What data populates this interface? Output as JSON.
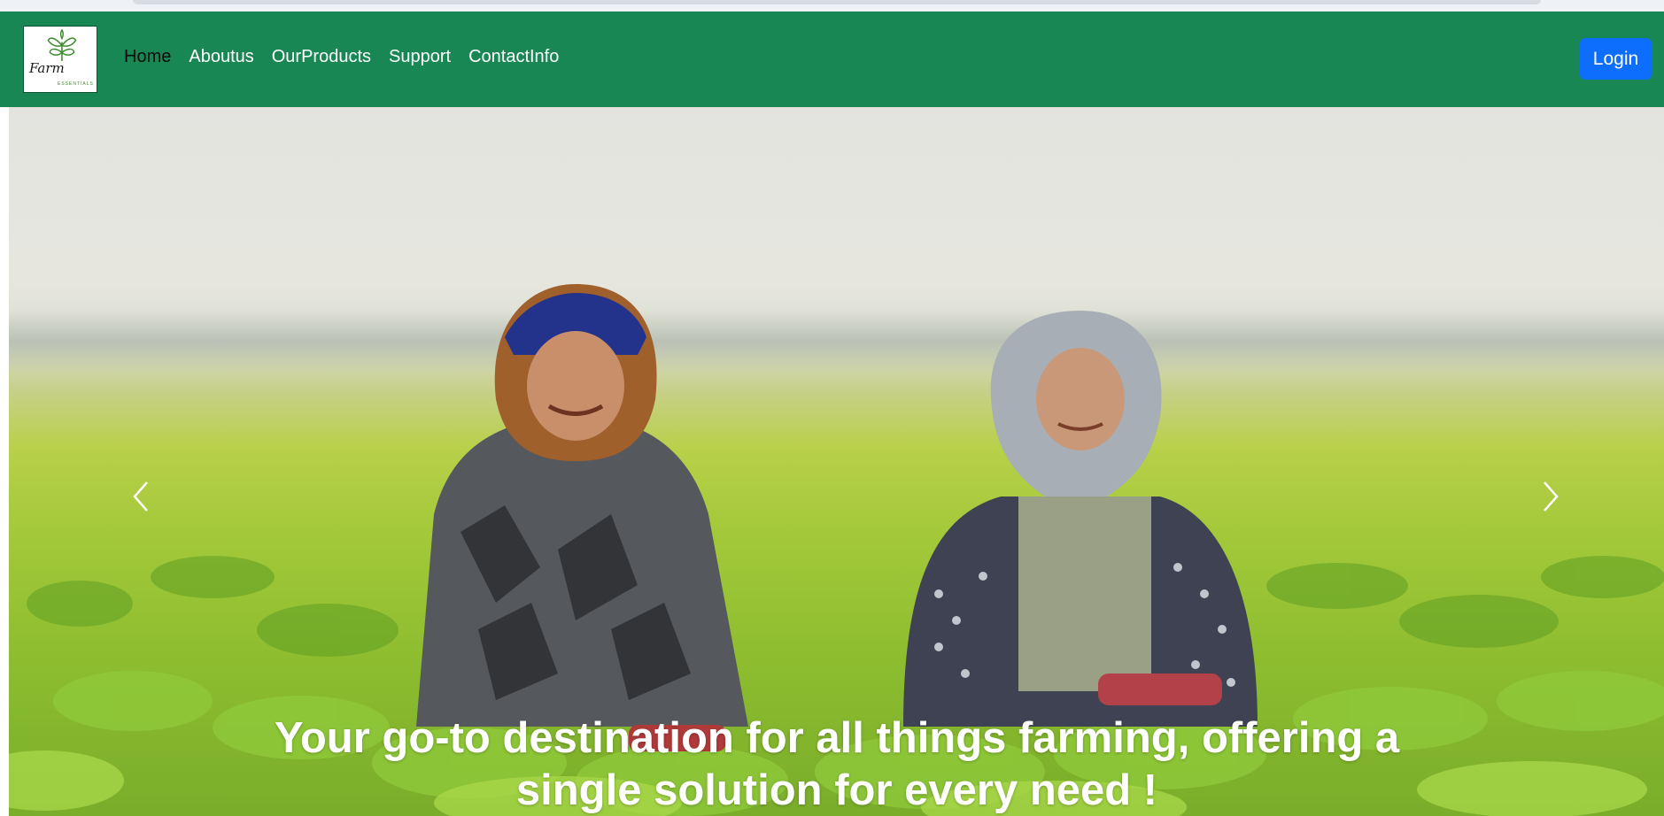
{
  "navbar": {
    "logo": {
      "text": "Farm",
      "subtext": "ESSENTIALS"
    },
    "links": [
      {
        "label": "Home",
        "active": true
      },
      {
        "label": "Aboutus",
        "active": false
      },
      {
        "label": "OurProducts",
        "active": false
      },
      {
        "label": "Support",
        "active": false
      },
      {
        "label": "ContactInfo",
        "active": false
      }
    ],
    "login_label": "Login"
  },
  "carousel": {
    "caption": "Your go-to destination for all things farming, offering a single solution for every need !",
    "prev_icon": "chevron-left-icon",
    "next_icon": "chevron-right-icon"
  },
  "colors": {
    "navbar_bg": "#198754",
    "login_bg": "#0d6efd"
  }
}
